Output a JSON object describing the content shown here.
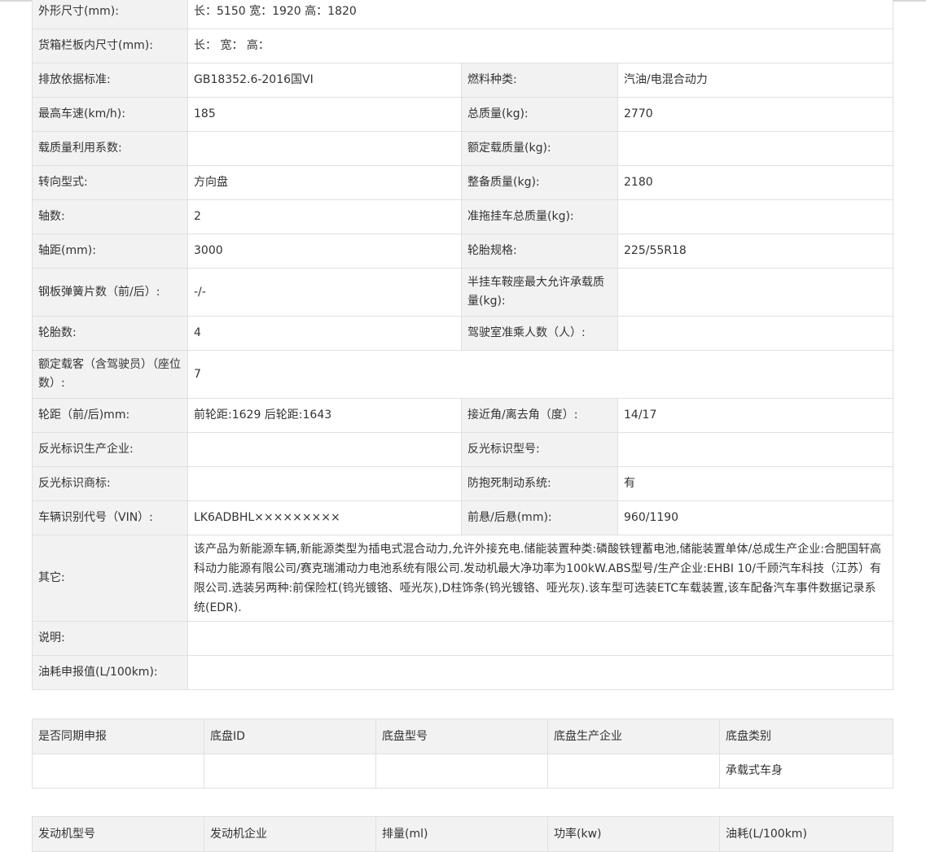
{
  "params": {
    "dimensions": {
      "label": "外形尺寸(mm):",
      "value": "长：5150 宽：1920 高：1820"
    },
    "cargo_box": {
      "label": "货箱栏板内尺寸(mm):",
      "value": "长： 宽： 高："
    },
    "emission": {
      "label": "排放依据标准:",
      "value": "GB18352.6-2016国VI"
    },
    "fuel": {
      "label": "燃料种类:",
      "value": "汽油/电混合动力"
    },
    "max_speed": {
      "label": "最高车速(km/h):",
      "value": "185"
    },
    "total_mass": {
      "label": "总质量(kg):",
      "value": "2770"
    },
    "load_util": {
      "label": "载质量利用系数:",
      "value": ""
    },
    "rated_load": {
      "label": "额定载质量(kg):",
      "value": ""
    },
    "steering": {
      "label": "转向型式:",
      "value": "方向盘"
    },
    "curb_mass": {
      "label": "整备质量(kg):",
      "value": "2180"
    },
    "axles": {
      "label": "轴数:",
      "value": "2"
    },
    "trailer_mass": {
      "label": "准拖挂车总质量(kg):",
      "value": ""
    },
    "wheelbase": {
      "label": "轴距(mm):",
      "value": "3000"
    },
    "tire_spec": {
      "label": "轮胎规格:",
      "value": "225/55R18"
    },
    "leaf_springs": {
      "label": "钢板弹簧片数（前/后）:",
      "value": "-/-"
    },
    "saddle_load": {
      "label": "半挂车鞍座最大允许承载质量(kg):",
      "value": ""
    },
    "tire_count": {
      "label": "轮胎数:",
      "value": "4"
    },
    "cab_seats": {
      "label": "驾驶室准乘人数（人）:",
      "value": ""
    },
    "passengers": {
      "label": "额定载客（含驾驶员）（座位数）:",
      "value": "7"
    },
    "track": {
      "label": "轮距（前/后)mm:",
      "value": "前轮距:1629 后轮距:1643"
    },
    "angles": {
      "label": "接近角/离去角（度）:",
      "value": "14/17"
    },
    "reflect_maker": {
      "label": "反光标识生产企业:",
      "value": ""
    },
    "reflect_model": {
      "label": "反光标识型号:",
      "value": ""
    },
    "reflect_brand": {
      "label": "反光标识商标:",
      "value": ""
    },
    "abs": {
      "label": "防抱死制动系统:",
      "value": "有"
    },
    "vin": {
      "label": "车辆识别代号（VIN）:",
      "value": "LK6ADBHL×××××××××"
    },
    "overhang": {
      "label": "前悬/后悬(mm):",
      "value": "960/1190"
    },
    "other": {
      "label": "其它:",
      "value": "该产品为新能源车辆,新能源类型为插电式混合动力,允许外接充电.储能装置种类:磷酸铁锂蓄电池,储能装置单体/总成生产企业:合肥国轩高科动力能源有限公司/赛克瑞浦动力电池系统有限公司.发动机最大净功率为100kW.ABS型号/生产企业:EHBI 10/千顾汽车科技（江苏）有限公司.选装另两种:前保险杠(钨光镀铬、哑光灰),D柱饰条(钨光镀铬、哑光灰).该车型可选装ETC车载装置,该车配备汽车事件数据记录系统(EDR)."
    },
    "note": {
      "label": "说明:",
      "value": ""
    },
    "fuel_consumption": {
      "label": "油耗申报值(L/100km):",
      "value": ""
    }
  },
  "chassis": {
    "headers": [
      "是否同期申报",
      "底盘ID",
      "底盘型号",
      "底盘生产企业",
      "底盘类别"
    ],
    "row": [
      "",
      "",
      "",
      "",
      "承载式车身"
    ]
  },
  "engine": {
    "headers": [
      "发动机型号",
      "发动机企业",
      "排量(ml)",
      "功率(kw)",
      "油耗(L/100km)"
    ]
  }
}
